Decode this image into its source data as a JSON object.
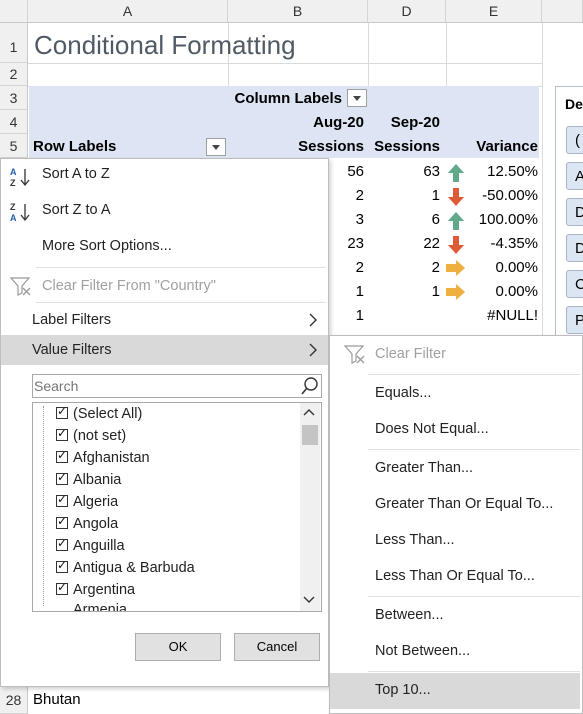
{
  "columns": [
    "A",
    "B",
    "D",
    "E"
  ],
  "rows": [
    "1",
    "2",
    "3",
    "4",
    "5"
  ],
  "bottom_row": {
    "num": "28",
    "value": "Bhutan"
  },
  "title": "Conditional Formatting",
  "pivot": {
    "column_labels": "Column Labels",
    "aug": "Aug-20",
    "sep": "Sep-20",
    "sessions_b": "Sessions",
    "sessions_d": "Sessions",
    "variance": "Variance",
    "row_labels": "Row Labels",
    "data": [
      {
        "b": "56",
        "d": "63",
        "arrow": "up",
        "e": "12.50%"
      },
      {
        "b": "2",
        "d": "1",
        "arrow": "down",
        "e": "-50.00%"
      },
      {
        "b": "3",
        "d": "6",
        "arrow": "up",
        "e": "100.00%"
      },
      {
        "b": "23",
        "d": "22",
        "arrow": "down",
        "e": "-4.35%"
      },
      {
        "b": "2",
        "d": "2",
        "arrow": "right",
        "e": "0.00%"
      },
      {
        "b": "1",
        "d": "1",
        "arrow": "right",
        "e": "0.00%"
      },
      {
        "b": "1",
        "d": "",
        "arrow": "",
        "e": "#NULL!"
      }
    ]
  },
  "slicer": {
    "header": "De",
    "items": [
      "(",
      "A",
      "D",
      "D",
      "C",
      "P"
    ]
  },
  "filter_menu": {
    "sort_az": "Sort A to Z",
    "sort_za": "Sort Z to A",
    "more_sort": "More Sort Options...",
    "clear_filter": "Clear Filter From \"Country\"",
    "label_filters": "Label Filters",
    "value_filters": "Value Filters",
    "search_placeholder": "Search",
    "list": [
      "(Select All)",
      "(not set)",
      "Afghanistan",
      "Albania",
      "Algeria",
      "Angola",
      "Anguilla",
      "Antigua & Barbuda",
      "Argentina",
      "Armenia"
    ],
    "ok": "OK",
    "cancel": "Cancel"
  },
  "value_submenu": {
    "clear_filter": "Clear Filter",
    "items": [
      "Equals...",
      "Does Not Equal...",
      "Greater Than...",
      "Greater Than Or Equal To...",
      "Less Than...",
      "Less Than Or Equal To...",
      "Between...",
      "Not Between...",
      "Top 10..."
    ]
  },
  "colors": {
    "up": "#5fa88a",
    "down": "#e05a3a",
    "right": "#f0b040",
    "header_band": "#dde5f4",
    "title": "#505a64"
  }
}
